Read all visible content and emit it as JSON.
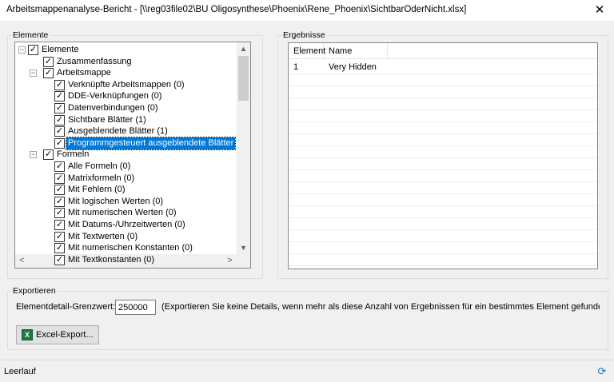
{
  "window": {
    "title": "Arbeitsmappenanalyse-Bericht - [\\\\reg03file02\\BU Oligosynthese\\Phoenix\\Rene_Phoenix\\SichtbarOderNicht.xlsx]",
    "close_icon": "close-icon"
  },
  "elements_group": {
    "label": "Elemente",
    "tree": [
      {
        "label": "Elemente",
        "level": 0,
        "expander": "−",
        "checked": true
      },
      {
        "label": "Zusammenfassung",
        "level": 1,
        "expander": "",
        "checked": true
      },
      {
        "label": "Arbeitsmappe",
        "level": 1,
        "expander": "−",
        "checked": true
      },
      {
        "label": "Verknüpfte Arbeitsmappen (0)",
        "level": 2,
        "expander": "",
        "checked": true
      },
      {
        "label": "DDE-Verknüpfungen (0)",
        "level": 2,
        "expander": "",
        "checked": true
      },
      {
        "label": "Datenverbindungen (0)",
        "level": 2,
        "expander": "",
        "checked": true
      },
      {
        "label": "Sichtbare Blätter (1)",
        "level": 2,
        "expander": "",
        "checked": true
      },
      {
        "label": "Ausgeblendete Blätter (1)",
        "level": 2,
        "expander": "",
        "checked": true
      },
      {
        "label": "Programmgesteuert ausgeblendete Blätter",
        "level": 2,
        "expander": "",
        "checked": true,
        "selected": true
      },
      {
        "label": "Formeln",
        "level": 1,
        "expander": "−",
        "checked": true
      },
      {
        "label": "Alle Formeln (0)",
        "level": 2,
        "expander": "",
        "checked": true
      },
      {
        "label": "Matrixformeln (0)",
        "level": 2,
        "expander": "",
        "checked": true
      },
      {
        "label": "Mit Fehlern (0)",
        "level": 2,
        "expander": "",
        "checked": true
      },
      {
        "label": "Mit logischen Werten (0)",
        "level": 2,
        "expander": "",
        "checked": true
      },
      {
        "label": "Mit numerischen Werten (0)",
        "level": 2,
        "expander": "",
        "checked": true
      },
      {
        "label": "Mit Datums-/Uhrzeitwerten (0)",
        "level": 2,
        "expander": "",
        "checked": true
      },
      {
        "label": "Mit Textwerten (0)",
        "level": 2,
        "expander": "",
        "checked": true
      },
      {
        "label": "Mit numerischen Konstanten (0)",
        "level": 2,
        "expander": "",
        "checked": true
      },
      {
        "label": "Mit Textkonstanten (0)",
        "level": 2,
        "expander": "",
        "checked": true
      }
    ],
    "scroll": {
      "up": "▲",
      "down": "▼",
      "left": "<",
      "right": ">"
    }
  },
  "results_group": {
    "label": "Ergebnisse",
    "columns": [
      "Element",
      "Name"
    ],
    "rows": [
      [
        "1",
        "Very Hidden"
      ]
    ]
  },
  "export_group": {
    "label": "Exportieren",
    "threshold_label": "Elementdetail-Grenzwert:",
    "threshold_value": "250000",
    "hint": "(Exportieren Sie keine Details, wenn mehr als diese Anzahl von Ergebnissen für ein bestimmtes Element gefunden werden",
    "export_button": "Excel-Export...",
    "excel_icon": "excel-icon"
  },
  "statusbar": {
    "text": "Leerlauf",
    "refresh_icon": "refresh-icon"
  }
}
